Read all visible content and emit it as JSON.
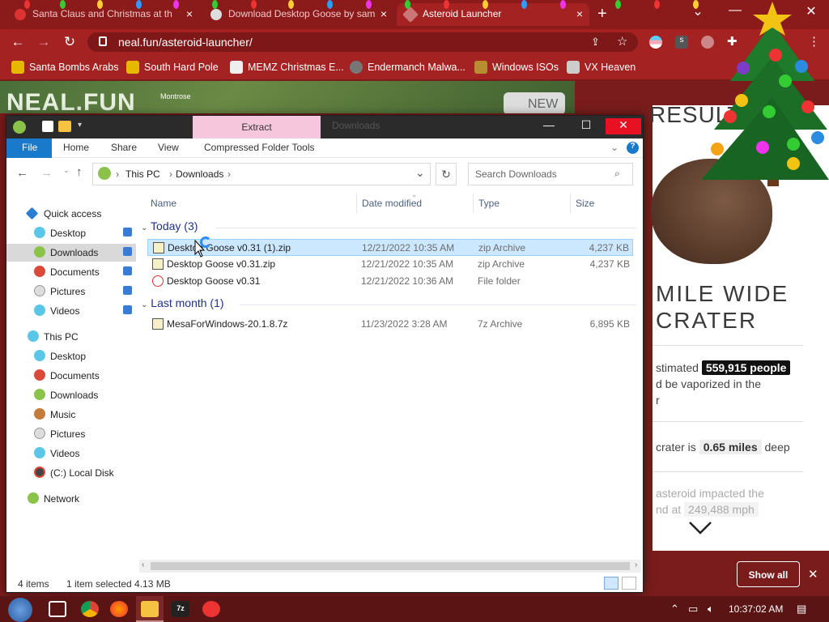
{
  "browser": {
    "tabs": [
      {
        "title": "Santa Claus and Christmas at th",
        "active": false
      },
      {
        "title": "Download Desktop Goose by sam",
        "active": false
      },
      {
        "title": "Asteroid Launcher",
        "active": true
      }
    ],
    "new_tab": "+",
    "url": "neal.fun/asteroid-launcher/",
    "profile_initial": "s",
    "bookmarks": [
      "Santa Bombs Arabs",
      "South Hard Pole",
      "MEMZ Christmas E...",
      "Endermanch Malwa...",
      "Windows ISOs",
      "VX Heaven"
    ]
  },
  "page": {
    "logo": "NEAL.FUN",
    "map_label": "Montrose",
    "new_badge": "NEW",
    "results_heading": "RESULT",
    "crater_heading_1": "MILE WIDE",
    "crater_heading_2": "CRATER",
    "vapor_pre": "stimated",
    "vapor_people": "559,915 people",
    "vapor_line2": "d be vaporized in the",
    "vapor_line3": "r",
    "depth_pre": "crater is",
    "depth_value": "0.65 miles",
    "depth_post": "deep",
    "impact_line1": "asteroid impacted the",
    "impact_line2": "nd at",
    "impact_speed": "249,488 mph",
    "scroll_icon": "chevron-down-icon"
  },
  "downloads_bar": {
    "show_all": "Show all",
    "close": "✕"
  },
  "explorer": {
    "context_tab": "Extract",
    "window_title": "Downloads",
    "ribbon_tabs": [
      "File",
      "Home",
      "Share",
      "View",
      "Compressed Folder Tools"
    ],
    "breadcrumb": [
      "This PC",
      "Downloads"
    ],
    "search_placeholder": "Search Downloads",
    "nav": {
      "quick_access": "Quick access",
      "quick_items": [
        "Desktop",
        "Downloads",
        "Documents",
        "Pictures",
        "Videos"
      ],
      "this_pc": "This PC",
      "pc_items": [
        "Desktop",
        "Documents",
        "Downloads",
        "Music",
        "Pictures",
        "Videos",
        "(C:) Local Disk"
      ],
      "network": "Network"
    },
    "columns": [
      "Name",
      "Date modified",
      "Type",
      "Size"
    ],
    "groups": [
      {
        "label": "Today (3)",
        "files": [
          {
            "name": "Desktop Goose v0.31 (1).zip",
            "date": "12/21/2022 10:35 AM",
            "type": "zip Archive",
            "size": "4,237 KB",
            "selected": true
          },
          {
            "name": "Desktop Goose v0.31.zip",
            "date": "12/21/2022 10:35 AM",
            "type": "zip Archive",
            "size": "4,237 KB",
            "selected": false
          },
          {
            "name": "Desktop Goose v0.31",
            "date": "12/21/2022 10:36 AM",
            "type": "File folder",
            "size": "",
            "selected": false
          }
        ]
      },
      {
        "label": "Last month (1)",
        "files": [
          {
            "name": "MesaForWindows-20.1.8.7z",
            "date": "11/23/2022 3:28 AM",
            "type": "7z Archive",
            "size": "6,895 KB",
            "selected": false
          }
        ]
      }
    ],
    "status": {
      "count": "4 items",
      "selection": "1 item selected  4.13 MB"
    }
  },
  "taskbar": {
    "clock": "10:37:02 AM"
  },
  "colors": {
    "browser_frame": "#a52222",
    "tab_strip": "#8b1a1a",
    "selection": "#cce8ff",
    "file_tab": "#1979ca",
    "extract_tab": "#f6c7dc"
  }
}
